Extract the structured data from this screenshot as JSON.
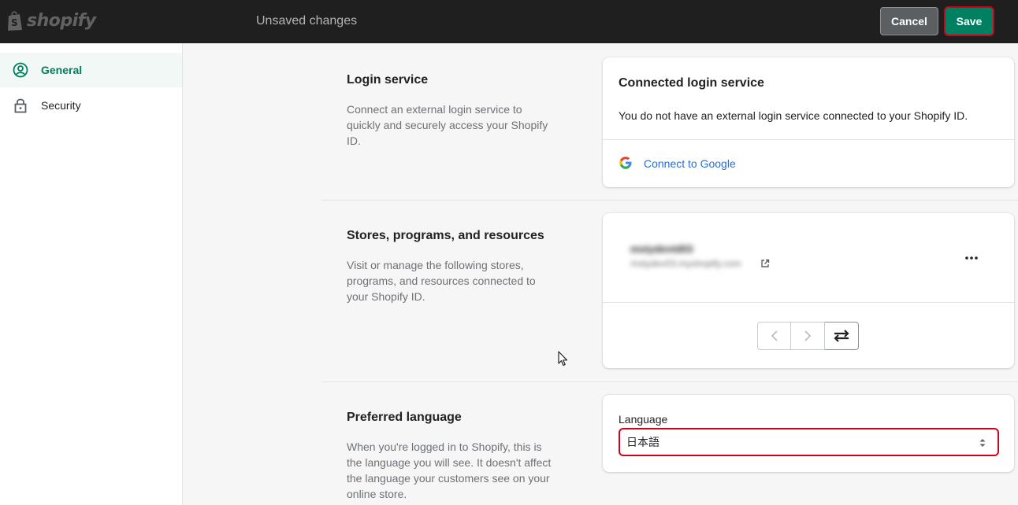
{
  "topbar": {
    "logo_text": "shopify",
    "status_text": "Unsaved changes",
    "cancel_label": "Cancel",
    "save_label": "Save"
  },
  "sidebar": {
    "items": [
      {
        "label": "General",
        "icon": "profile-icon",
        "active": true
      },
      {
        "label": "Security",
        "icon": "lock-icon",
        "active": false
      }
    ]
  },
  "login_service": {
    "title": "Login service",
    "description": "Connect an external login service to quickly and securely access your Shopify ID.",
    "card": {
      "heading": "Connected login service",
      "text": "You do not have an external login service connected to your Shopify ID.",
      "connect_label": "Connect to Google",
      "connect_icon": "google-icon"
    }
  },
  "stores": {
    "title": "Stores, programs, and resources",
    "description": "Visit or manage the following stores, programs, and resources connected to your Shopify ID.",
    "card": {
      "store_name": "mstydevtd03",
      "store_url": "mstydev03.myshopify.com",
      "external_icon": "external-link-icon",
      "more_icon": "more-horizontal-icon",
      "prev_icon": "chevron-left-icon",
      "next_icon": "chevron-right-icon",
      "swap_icon": "swap-arrows-icon"
    }
  },
  "language": {
    "title": "Preferred language",
    "description": "When you're logged in to Shopify, this is the language you will see. It doesn't affect the language your customers see on your online store.",
    "field_label": "Language",
    "selected_value": "日本語"
  },
  "colors": {
    "accent_green": "#008060",
    "link_blue": "#2c6ecb",
    "highlight_red": "#d0021b",
    "topbar_bg": "#1f1f1f"
  }
}
